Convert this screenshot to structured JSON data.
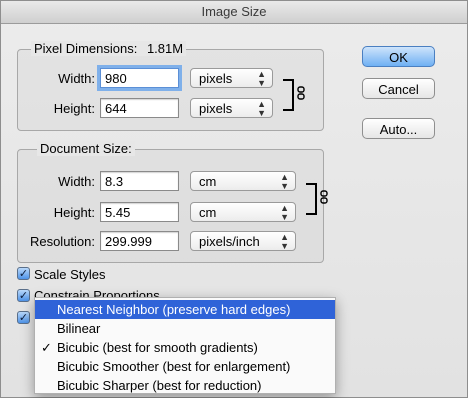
{
  "title": "Image Size",
  "pixel_dimensions": {
    "heading": "Pixel Dimensions:",
    "size": "1.81M",
    "width_label": "Width:",
    "width_value": "980",
    "width_unit": "pixels",
    "height_label": "Height:",
    "height_value": "644",
    "height_unit": "pixels"
  },
  "document_size": {
    "heading": "Document Size:",
    "width_label": "Width:",
    "width_value": "8.3",
    "width_unit": "cm",
    "height_label": "Height:",
    "height_value": "5.45",
    "height_unit": "cm",
    "resolution_label": "Resolution:",
    "resolution_value": "299.999",
    "resolution_unit": "pixels/inch"
  },
  "buttons": {
    "ok": "OK",
    "cancel": "Cancel",
    "auto": "Auto..."
  },
  "options": {
    "scale_styles": "Scale Styles",
    "constrain_proportions": "Constrain Proportions"
  },
  "resample_menu": {
    "items": [
      "Nearest Neighbor (preserve hard edges)",
      "Bilinear",
      "Bicubic (best for smooth gradients)",
      "Bicubic Smoother (best for enlargement)",
      "Bicubic Sharper (best for reduction)"
    ],
    "highlighted_index": 0,
    "checked_index": 2
  },
  "icons": {
    "checkmark": "✓",
    "chain_link": "link-icon",
    "stepper_arrows": "▲▼"
  }
}
